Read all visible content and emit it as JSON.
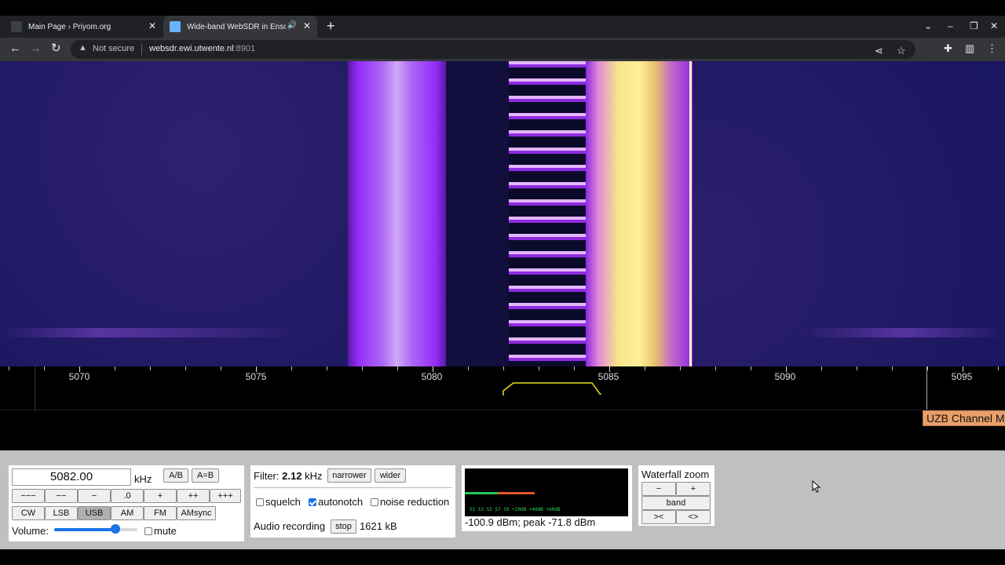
{
  "browser": {
    "tabs": [
      {
        "title": "Main Page › Priyom.org",
        "close": "✕"
      },
      {
        "title": "Wide-band WebSDR in Ensche",
        "close": "✕",
        "audio": "🔊"
      }
    ],
    "new_tab": "+",
    "omnibox": {
      "security": "Not secure",
      "url_host": "websdr.ewi.utwente.nl",
      "url_port": ":8901"
    }
  },
  "scale": {
    "labels": [
      "5070",
      "5075",
      "5080",
      "5085",
      "5090",
      "5095"
    ],
    "station_label": "UZB Channel M"
  },
  "controls": {
    "frequency": "5082.00",
    "freq_unit": "kHz",
    "ab_button": "A/B",
    "aeqb_button": "A=B",
    "step_buttons": [
      "−−−",
      "−−",
      "−",
      ".0",
      "+",
      "++",
      "+++"
    ],
    "mode_buttons": [
      "CW",
      "LSB",
      "USB",
      "AM",
      "FM",
      "AMsync"
    ],
    "selected_mode": "USB",
    "volume_label": "Volume:",
    "volume_level": 0.75,
    "mute_label": "mute"
  },
  "filter": {
    "label": "Filter:",
    "value": "2.12",
    "unit": "kHz",
    "narrower": "narrower",
    "wider": "wider",
    "squelch": "squelch",
    "autonotch": "autonotch",
    "noise_reduction": "noise reduction",
    "audio_recording": "Audio recording",
    "stop": "stop",
    "size": "1621 kB"
  },
  "smeter": {
    "scale_text": "S1   S3   S5   S7   S9   +20dB  +40dB  +60dB",
    "reading": "-100.9 dBm; peak  -71.8 dBm"
  },
  "zoom": {
    "title": "Waterfall zoom",
    "minus": "−",
    "plus": "+",
    "band": "band",
    "narrow": "><",
    "wide": "<>"
  },
  "colors": {
    "accent": "#1a73e8",
    "station_label_bg": "#e8a06a",
    "passband": "#e8e01a"
  }
}
